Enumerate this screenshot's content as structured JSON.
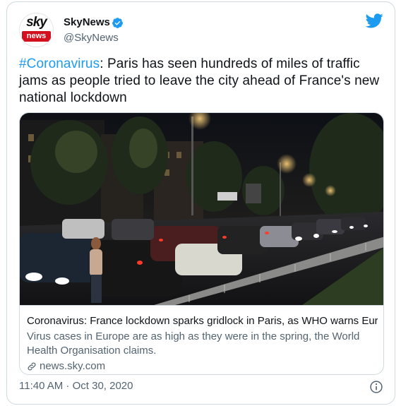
{
  "tweet": {
    "avatar": {
      "brand_word": "sky",
      "brand_bar": "news"
    },
    "author": {
      "display_name": "SkyNews",
      "handle": "@SkyNews"
    },
    "text": {
      "hashtag": "#Coronavirus",
      "body": ": Paris has seen hundreds of miles of traffic jams as people tried to leave the city ahead of France's new national lockdown"
    },
    "link_card": {
      "image_alt": "Night photo of gridlocked traffic on a Paris road with a man standing among cars",
      "title": "Coronavirus: France lockdown sparks gridlock in Paris, as WHO warns Eur...",
      "description": "Virus cases in Europe are as high as they were in the spring, the World Health Organisation claims.",
      "domain": "news.sky.com"
    },
    "timestamp": "11:40 AM · Oct 30, 2020"
  },
  "icons": {
    "verified": "verified-badge-icon",
    "twitter": "twitter-bird-icon",
    "link": "link-icon",
    "info": "info-icon"
  },
  "colors": {
    "accent": "#1d9bf0",
    "text": "#0f1419",
    "muted": "#536471",
    "border": "#cfd9de",
    "sky_red": "#d3101e"
  }
}
